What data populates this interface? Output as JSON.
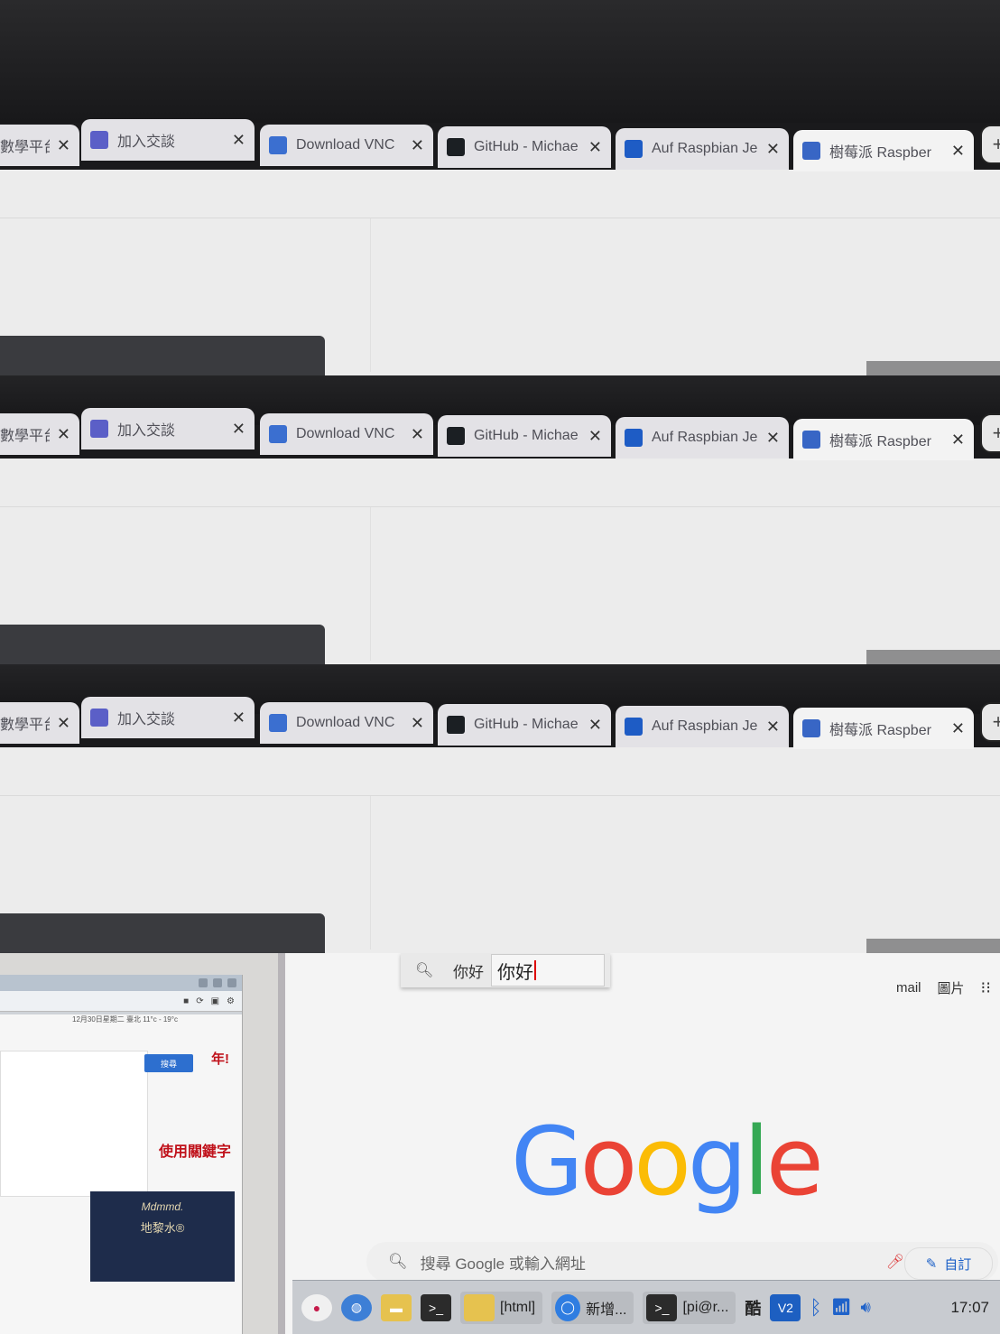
{
  "tabs": [
    {
      "label": "數學平台",
      "favicon": "unknown-favicon",
      "active": false
    },
    {
      "label": "加入交談",
      "favicon": "teams-icon",
      "color": "#5b5fc7",
      "active": false
    },
    {
      "label": "Download VNC",
      "favicon": "vnc-icon",
      "color": "#3b6fd0",
      "active": false
    },
    {
      "label": "GitHub - Michae",
      "favicon": "github-icon",
      "color": "#1b1f23",
      "active": false
    },
    {
      "label": "Auf Raspbian Je",
      "favicon": "flag-icon",
      "color": "#1e5cc5",
      "active": false
    },
    {
      "label": "樹莓派 Raspber",
      "favicon": "g-icon",
      "color": "#3866c5",
      "active": true
    }
  ],
  "tab_close_glyph": "✕",
  "new_tab_glyph": "+",
  "ime": {
    "search_icon": "search-icon",
    "preedit": "你好",
    "candidate": "你好"
  },
  "google": {
    "links": [
      "mail",
      "圖片"
    ],
    "apps_icon": "apps-grid-icon",
    "logo_letters": [
      "G",
      "o",
      "o",
      "g",
      "l",
      "e"
    ],
    "logo_colors": [
      "#4285f4",
      "#ea4335",
      "#fbbc05",
      "#4285f4",
      "#34a853",
      "#ea4335"
    ],
    "search_placeholder": "搜尋 Google 或輸入網址",
    "customize_label": "自訂"
  },
  "left_window": {
    "date_text": "12月30日星期二 臺北 11°c - 19°c",
    "search_button": "搜尋",
    "red_text_1": "年!",
    "red_headline": "使用關鍵字",
    "ad_brand": "Mdmmd.",
    "ad_title": "地黎水®"
  },
  "taskbar": {
    "items": [
      {
        "name": "raspberry-menu-icon",
        "label": ""
      },
      {
        "name": "browser-globe-icon",
        "label": ""
      },
      {
        "name": "file-manager-icon",
        "label": ""
      },
      {
        "name": "terminal-icon",
        "label": ""
      },
      {
        "name": "folder-html",
        "label": "[html]"
      },
      {
        "name": "chromium-new-tab",
        "label": "新增..."
      },
      {
        "name": "terminal-pi",
        "label": "[pi@r..."
      }
    ],
    "ime_indicator": "酷",
    "clock": "17:07"
  }
}
